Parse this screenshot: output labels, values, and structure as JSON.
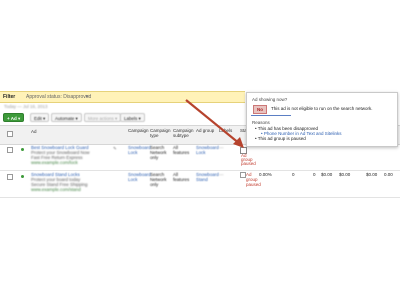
{
  "filter": {
    "label": "Filter",
    "criteria": "Approval status: Disapproved",
    "close_glyph": "✕"
  },
  "date_hint": "Today — Jul 16, 2013",
  "toolbar": {
    "add_label": "+ Ad ▾",
    "edit_label": "Edit ▾",
    "automate_label": "Automate ▾",
    "more_actions_label": "More actions ▾",
    "labels_label": "Labels ▾"
  },
  "table": {
    "columns": [
      "Ad",
      "Campaign",
      "Campaign type",
      "Campaign subtype",
      "Ad group",
      "Labels",
      "Status"
    ],
    "rows": [
      {
        "ad_headline": "Best Snowboard Lock Guard",
        "ad_line1": "Protect your Snowboard Now",
        "ad_line2": "Fast Free Return Express",
        "ad_url": "www.example.com/lock",
        "campaign": "Snowboard Lock",
        "campaign_type": "Search Network only",
        "campaign_subtype": "All features",
        "ad_group": "Snowboard Lock",
        "labels": "—",
        "status_1": "Ad",
        "status_2": "group",
        "status_3": "paused"
      },
      {
        "ad_headline": "Snowboard Stand Locks",
        "ad_line1": "Protect your board today",
        "ad_line2": "Secure Stand Free Shipping",
        "ad_url": "www.example.com/stand",
        "campaign": "Snowboard Lock",
        "campaign_type": "Search Network only",
        "campaign_subtype": "All features",
        "ad_group": "Snowboard Stand",
        "labels": "—",
        "status_1": "Ad",
        "status_2": "group",
        "status_3": "paused",
        "metrics": [
          "0.00%",
          "0",
          "0",
          "$0.00",
          "$0.00",
          "$0.00",
          "0.00"
        ]
      }
    ]
  },
  "panel": {
    "title": "Ad showing now?",
    "badge": "No",
    "message": "This ad is not eligible to run on the search network.",
    "reasons_label": "Reasons",
    "reasons": [
      "This ad has been disapproved",
      "Phone Number in Ad Text and Sitelinks",
      "This ad group is paused"
    ]
  },
  "colors": {
    "filter_bg": "#fff2b8",
    "add_button": "#3d9a3a",
    "arrow": "#b6432d",
    "link": "#2a5db0"
  }
}
